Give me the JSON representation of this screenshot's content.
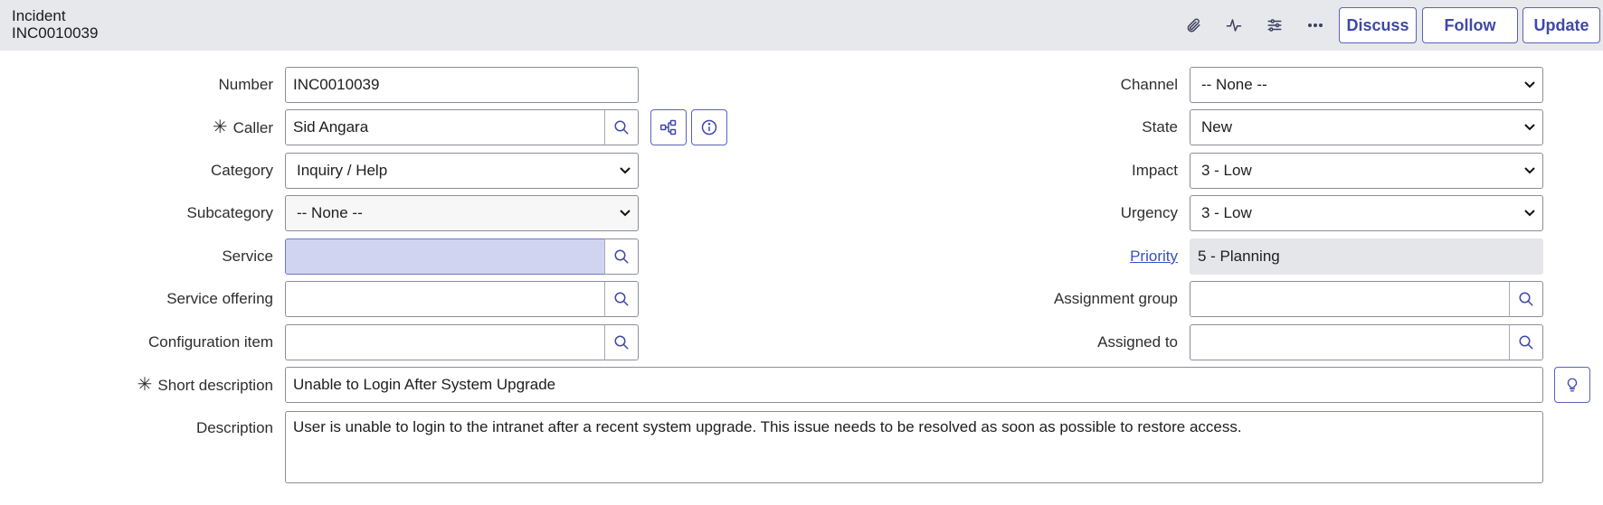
{
  "header": {
    "record_type": "Incident",
    "record_number": "INC0010039",
    "icons": [
      "paperclip-icon",
      "activity-pulse-icon",
      "sliders-icon",
      "more-icon"
    ],
    "buttons": {
      "discuss": "Discuss",
      "follow": "Follow",
      "update": "Update"
    }
  },
  "form": {
    "number": {
      "label": "Number",
      "value": "INC0010039"
    },
    "caller": {
      "label": "Caller",
      "value": "Sid Angara",
      "required": true
    },
    "category": {
      "label": "Category",
      "value": "Inquiry / Help"
    },
    "subcategory": {
      "label": "Subcategory",
      "value": "-- None --"
    },
    "service": {
      "label": "Service",
      "value": ""
    },
    "service_offering": {
      "label": "Service offering",
      "value": ""
    },
    "configuration_item": {
      "label": "Configuration item",
      "value": ""
    },
    "channel": {
      "label": "Channel",
      "value": "-- None --"
    },
    "state": {
      "label": "State",
      "value": "New"
    },
    "impact": {
      "label": "Impact",
      "value": "3 - Low"
    },
    "urgency": {
      "label": "Urgency",
      "value": "3 - Low"
    },
    "priority": {
      "label": "Priority",
      "value": "5 - Planning"
    },
    "assignment_group": {
      "label": "Assignment group",
      "value": ""
    },
    "assigned_to": {
      "label": "Assigned to",
      "value": ""
    },
    "short_description": {
      "label": "Short description",
      "value": "Unable to Login After System Upgrade",
      "required": true
    },
    "description": {
      "label": "Description",
      "value": "User is unable to login to the intranet after a recent system upgrade. This issue needs to be resolved as soon as possible to restore access."
    }
  },
  "colors": {
    "accent": "#3f48a8",
    "header_bg": "#e6e8ec",
    "highlight": "#d1d4f0",
    "readonly": "#e4e6ea"
  }
}
